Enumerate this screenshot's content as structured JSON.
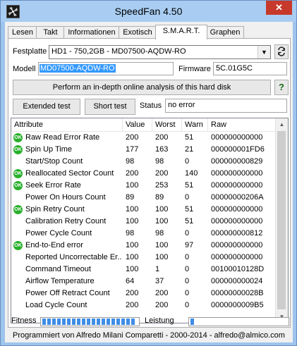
{
  "window": {
    "title": "SpeedFan 4.50",
    "close_glyph": "✕"
  },
  "tabs": [
    "Lesen",
    "Takt",
    "Informationen",
    "Exotisch",
    "S.M.A.R.T.",
    "Graphen"
  ],
  "active_tab": "S.M.A.R.T.",
  "drive": {
    "label": "Festplatte",
    "value": "HD1 - 750,2GB - MD07500-AQDW-RO",
    "model_label": "Modell",
    "model_value": "MD07500-AQDW-RO",
    "firmware_label": "Firmware",
    "firmware_value": "5C.01G5C"
  },
  "buttons": {
    "analysis": "Perform an in-depth online analysis of this hard disk",
    "help": "?",
    "extended": "Extended test",
    "short": "Short test"
  },
  "test_status": {
    "label": "Status",
    "value": "no error"
  },
  "table": {
    "headers": [
      "Attribute",
      "Value",
      "Worst",
      "Warn",
      "Raw"
    ],
    "rows": [
      {
        "ok": true,
        "attribute": "Raw Read Error Rate",
        "value": "200",
        "worst": "200",
        "warn": "51",
        "raw": "000000000000"
      },
      {
        "ok": true,
        "attribute": "Spin Up Time",
        "value": "177",
        "worst": "163",
        "warn": "21",
        "raw": "000000001FD6"
      },
      {
        "ok": false,
        "attribute": "Start/Stop Count",
        "value": "98",
        "worst": "98",
        "warn": "0",
        "raw": "000000000829"
      },
      {
        "ok": true,
        "attribute": "Reallocated Sector Count",
        "value": "200",
        "worst": "200",
        "warn": "140",
        "raw": "000000000000"
      },
      {
        "ok": true,
        "attribute": "Seek Error Rate",
        "value": "100",
        "worst": "253",
        "warn": "51",
        "raw": "000000000000"
      },
      {
        "ok": false,
        "attribute": "Power On Hours Count",
        "value": "89",
        "worst": "89",
        "warn": "0",
        "raw": "00000000206A"
      },
      {
        "ok": true,
        "attribute": "Spin Retry Count",
        "value": "100",
        "worst": "100",
        "warn": "51",
        "raw": "000000000000"
      },
      {
        "ok": false,
        "attribute": "Calibration Retry Count",
        "value": "100",
        "worst": "100",
        "warn": "51",
        "raw": "000000000000"
      },
      {
        "ok": false,
        "attribute": "Power Cycle Count",
        "value": "98",
        "worst": "98",
        "warn": "0",
        "raw": "000000000812"
      },
      {
        "ok": true,
        "attribute": "End-to-End error",
        "value": "100",
        "worst": "100",
        "warn": "97",
        "raw": "000000000000"
      },
      {
        "ok": false,
        "attribute": "Reported Uncorrectable Er...",
        "value": "100",
        "worst": "100",
        "warn": "0",
        "raw": "000000000000"
      },
      {
        "ok": false,
        "attribute": "Command Timeout",
        "value": "100",
        "worst": "1",
        "warn": "0",
        "raw": "00100010128D"
      },
      {
        "ok": false,
        "attribute": "Airflow Temperature",
        "value": "64",
        "worst": "37",
        "warn": "0",
        "raw": "000000000024"
      },
      {
        "ok": false,
        "attribute": "Power Off Retract Count",
        "value": "200",
        "worst": "200",
        "warn": "0",
        "raw": "00000000028B"
      },
      {
        "ok": false,
        "attribute": "Load Cycle Count",
        "value": "200",
        "worst": "200",
        "warn": "0",
        "raw": "0000000009B5"
      }
    ],
    "ok_badge": "OK"
  },
  "scroll": {
    "up_glyph": "▲",
    "down_glyph": "▼"
  },
  "meters": {
    "fitness_label": "Fitness",
    "fitness_level": 1.0,
    "performance_label": "Leistung",
    "performance_level": 0.03,
    "bar_color": "#3e8de6"
  },
  "status_bar": "Programmiert von Alfredo Milani Comparetti - 2000-2014 - alfredo@almico.com"
}
